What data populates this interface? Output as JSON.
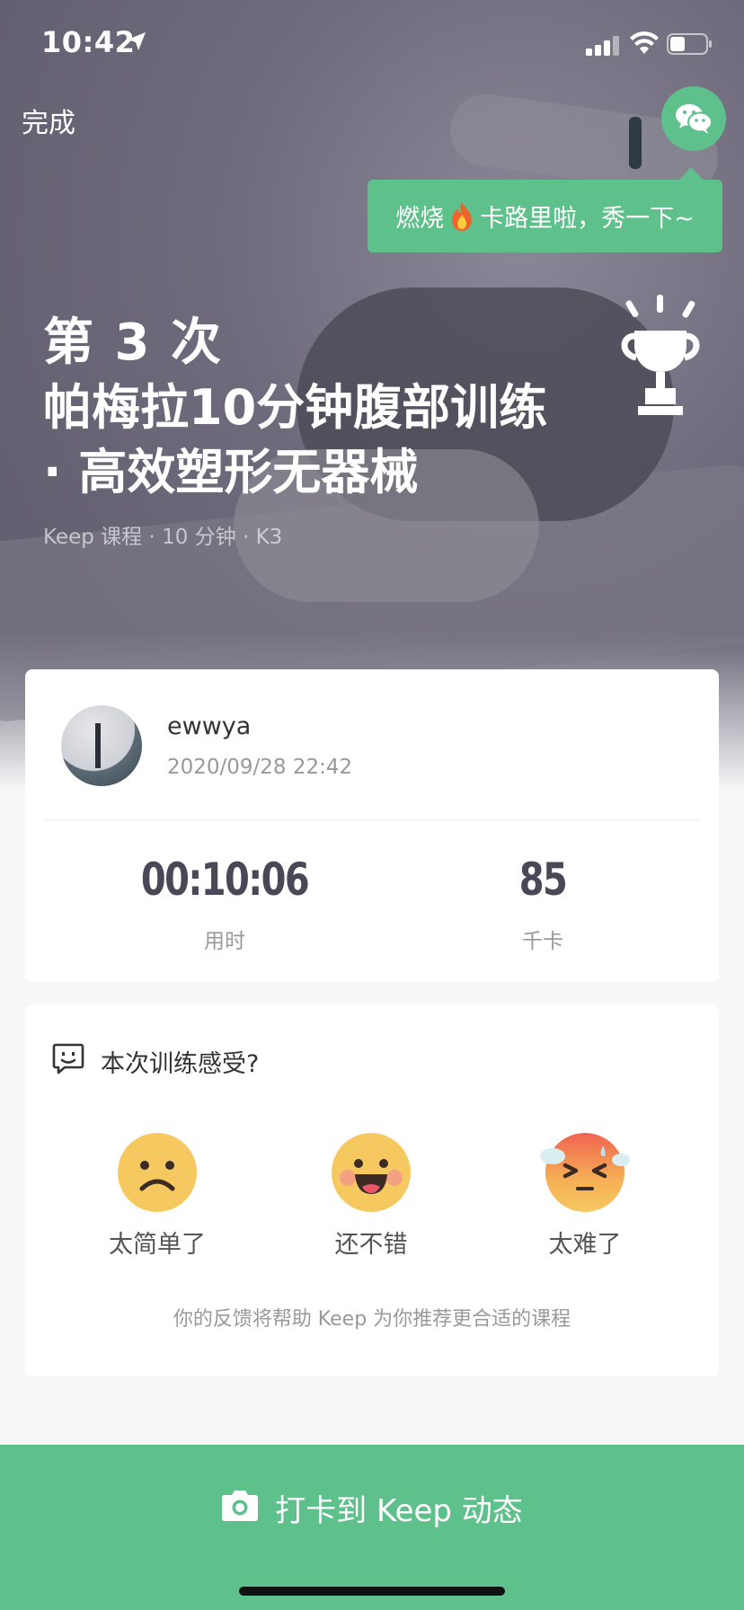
{
  "status_bar": {
    "time": "10:42"
  },
  "header": {
    "done_label": "完成"
  },
  "share": {
    "tooltip_before": "燃烧",
    "tooltip_after": "卡路里啦，秀一下~"
  },
  "workout": {
    "count_label": "第 3 次",
    "course_title": "帕梅拉10分钟腹部训练 · 高效塑形无器械",
    "meta": "Keep 课程 · 10 分钟 · K3"
  },
  "user": {
    "name": "ewwya",
    "timestamp": "2020/09/28 22:42"
  },
  "stats": {
    "duration_value": "00:10:06",
    "duration_label": "用时",
    "calories_value": "85",
    "calories_label": "千卡"
  },
  "feedback": {
    "title": "本次训练感受?",
    "options": [
      {
        "label": "太简单了",
        "icon": "sad-face-icon"
      },
      {
        "label": "还不错",
        "icon": "happy-face-icon"
      },
      {
        "label": "太难了",
        "icon": "sweating-face-icon"
      }
    ],
    "note": "你的反馈将帮助 Keep 为你推荐更合适的课程"
  },
  "bottom": {
    "post_label": "打卡到 Keep 动态"
  },
  "colors": {
    "accent": "#5ec08a",
    "stat_text": "#4a4756",
    "emoji_yellow": "#f6c860"
  }
}
